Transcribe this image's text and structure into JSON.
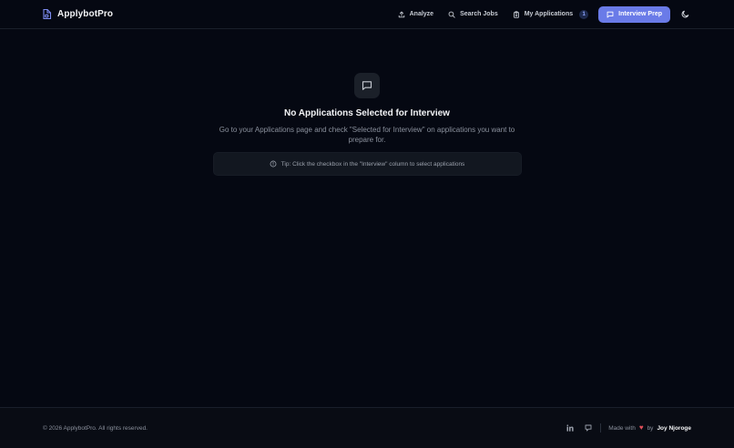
{
  "header": {
    "brand": "ApplybotPro",
    "nav": [
      {
        "label": "Analyze",
        "icon": "upload-icon"
      },
      {
        "label": "Search Jobs",
        "icon": "search-icon"
      },
      {
        "label": "My Applications",
        "icon": "clipboard-icon",
        "badge": "1"
      },
      {
        "label": "Interview Prep",
        "icon": "message-square-icon",
        "active": true
      }
    ],
    "theme_icon": "moon-icon"
  },
  "empty_state": {
    "icon": "message-square-icon",
    "title": "No Applications Selected for Interview",
    "description": "Go to your Applications page and check \"Selected for Interview\" on applications you want to prepare for.",
    "tip": "Tip: Click the checkbox in the \"Interview\" column to select applications"
  },
  "footer": {
    "copyright": "© 2026 ApplybotPro. All rights reserved.",
    "made_with": "Made with",
    "by": "by",
    "author": "Joy Njoroge",
    "social": [
      "linkedin-icon",
      "portfolio-icon"
    ]
  },
  "colors": {
    "background": "#050812",
    "accent": "#6a7be8",
    "heart": "#e0505a"
  }
}
